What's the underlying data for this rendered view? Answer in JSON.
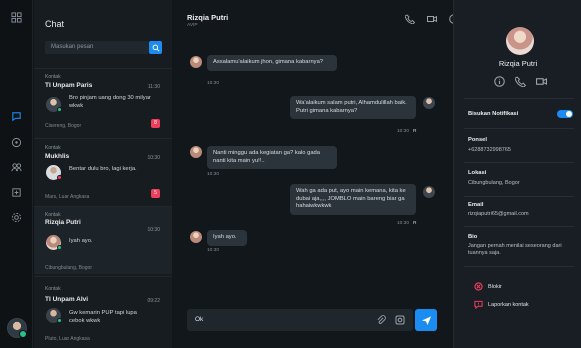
{
  "sidebar": {
    "icons": [
      "grid-icon",
      "chat-icon",
      "compass-icon",
      "users-icon",
      "pin-icon",
      "settings-icon"
    ]
  },
  "chat_list": {
    "title": "Chat",
    "search_placeholder": "Masukan pesan",
    "items": [
      {
        "tag": "Kontak",
        "name": "TI Unpam Paris",
        "time": "11:30",
        "message": "Bro pinjam uang dong 30 milyar wkwk",
        "location": "Cisereng, Bogor",
        "unread": "8"
      },
      {
        "tag": "Kontak",
        "name": "Mukhlis",
        "time": "10:30",
        "message": "Bentar dulu bro, lagi kerja.",
        "location": "Mars, Luar Angkasa",
        "unread": "5"
      },
      {
        "tag": "Kontak",
        "name": "Rizqia Putri",
        "time": "10:30",
        "message": "Iyah ayo.",
        "location": "Cibungbulang, Bogor",
        "unread": ""
      },
      {
        "tag": "Kontak",
        "name": "TI Unpam Alvi",
        "time": "09:22",
        "message": "Gw kemarin PUP tapi lupa cebok wkwk",
        "location": "Pluto, Luar Angkasa",
        "unread": ""
      }
    ]
  },
  "conversation": {
    "name": "Rizqia Putri",
    "status": "AVIP",
    "messages": [
      {
        "side": "left",
        "text": "Assalamu'alaikum jhon, gimana kabarnya?",
        "time": "10:30"
      },
      {
        "side": "right",
        "text": "Wa'alaikum salam putri, Alhamdulillah baik. Putri gimana kabarnya?",
        "time": "10:30"
      },
      {
        "side": "left",
        "text": "Nanti minggu ada kegiatan ga? kalo gada nanti kita main yu!!..",
        "time": "10:30"
      },
      {
        "side": "right",
        "text": "Wah ga ada put, ayo main kemana, kita ke dubai aja,,,, JOMBLO main bareng biar ga hahaiwkwkwk",
        "time": "10:30"
      },
      {
        "side": "left",
        "text": "Iyah ayo.",
        "time": "10:30"
      }
    ],
    "read_mark": "R",
    "composer_value": "Ok"
  },
  "profile": {
    "name": "Rizqia Putri",
    "notification_label": "Bisukan Notifikasi",
    "notification_on": true,
    "phone_label": "Ponsel",
    "phone": "+6288732998765",
    "location_label": "Lokasi",
    "location": "Cibungbulang, Bogor",
    "email_label": "Email",
    "email": "rizqiaputri65@gmail.com",
    "bio_label": "Bio",
    "bio": "Jangan pernah menilai seseorang dari tuannya saja.",
    "block_label": "Blokir",
    "report_label": "Laporkan kontak"
  },
  "colors": {
    "accent": "#1b8cf1",
    "badge": "#ef3e5c",
    "online": "#27c28b",
    "danger": "#ef3e5c"
  }
}
